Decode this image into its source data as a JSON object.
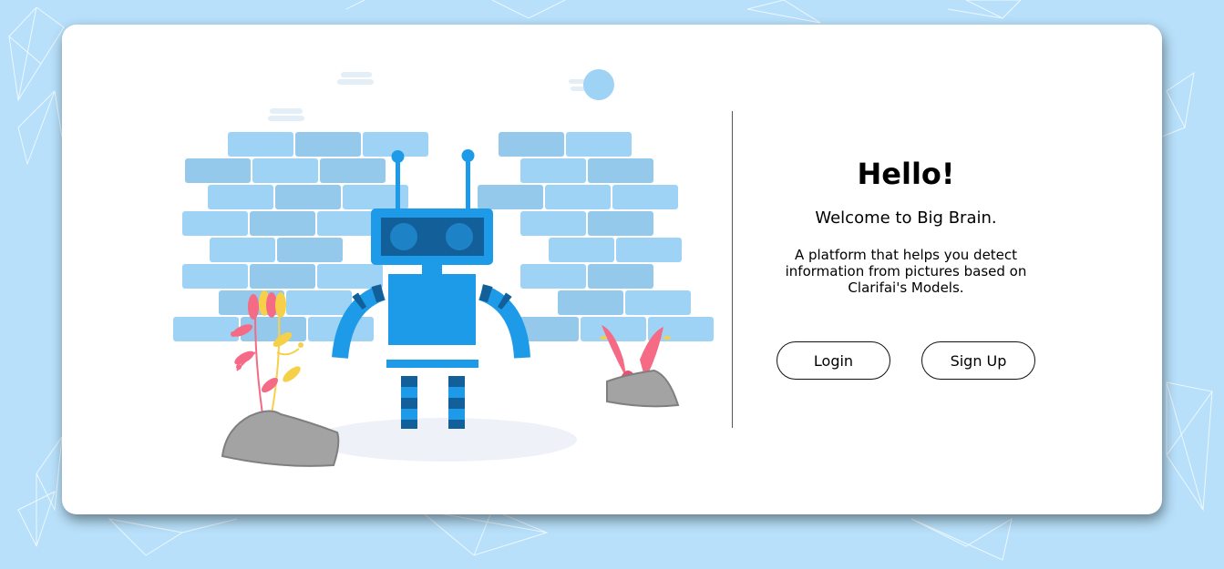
{
  "panel": {
    "greeting": "Hello!",
    "welcome": "Welcome to Big Brain.",
    "description": "A platform that helps you detect information from pictures based on Clarifai's Models."
  },
  "buttons": {
    "login_label": "Login",
    "signup_label": "Sign Up"
  },
  "colors": {
    "background": "#b8e0fa",
    "card": "#ffffff",
    "brick": "#9ed3f5",
    "robot": "#1e9be8",
    "robot_dark": "#125f99",
    "flower_pink": "#f56a85",
    "flower_yellow": "#f7d04a",
    "rock": "#a3a3a3"
  },
  "illustration": {
    "subject": "robot-in-front-of-brick-wall",
    "icons": [
      "robot-icon",
      "brick-wall-icon",
      "flower-icon",
      "rock-icon",
      "cloud-icon",
      "sun-icon"
    ]
  }
}
